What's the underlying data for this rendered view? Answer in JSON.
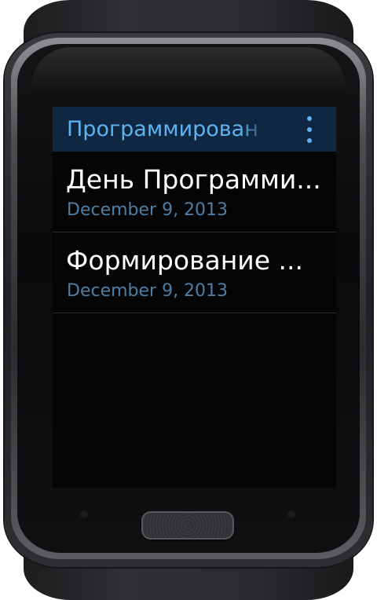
{
  "action_bar": {
    "title": "Программирован",
    "more_icon": "more-vertical-icon"
  },
  "list": {
    "items": [
      {
        "title": "День Программи...",
        "date": "December 9, 2013"
      },
      {
        "title": "Формирование ...",
        "date": "December 9, 2013"
      }
    ]
  },
  "colors": {
    "action_bar_bg": "#0f2740",
    "accent": "#5fb3f0",
    "date_text": "#4d7fa6",
    "screen_bg": "#050505"
  }
}
